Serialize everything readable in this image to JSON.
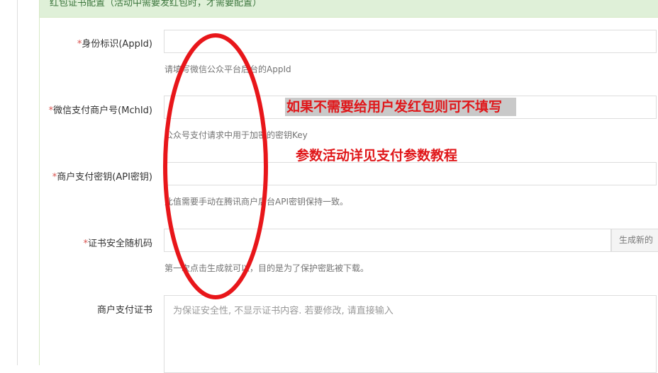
{
  "panel": {
    "heading": "红包证书配置（活动中需要发红包时，才需要配置）"
  },
  "form": {
    "required_mark": "*",
    "appid": {
      "label": "身份标识(AppId)",
      "value": "",
      "help": "请填写微信公众平台后台的AppId"
    },
    "mchid": {
      "label": "微信支付商户号(MchId)",
      "value": "",
      "help": "公众号支付请求中用于加密的密钥Key"
    },
    "apikey": {
      "label": "商户支付密钥(API密钥)",
      "value": "",
      "help": "此值需要手动在腾讯商户后台API密钥保持一致。"
    },
    "random_code": {
      "label": "证书安全随机码",
      "value": "",
      "button": "生成新的",
      "help": "第一次点击生成就可以，目的是为了保护密匙被下载。"
    },
    "cert": {
      "label": "商户支付证书",
      "placeholder": "为保证安全性, 不显示证书内容. 若要修改, 请直接输入"
    }
  },
  "annotations": {
    "note1": "如果不需要给用户发红包则可不填写",
    "note2": "参数活动详见支付参数教程",
    "color": "#e0171a"
  },
  "colors": {
    "panel_heading_bg": "#dff0d8",
    "panel_heading_text": "#3c763d",
    "required": "#d9534f",
    "help_text": "#737373"
  }
}
